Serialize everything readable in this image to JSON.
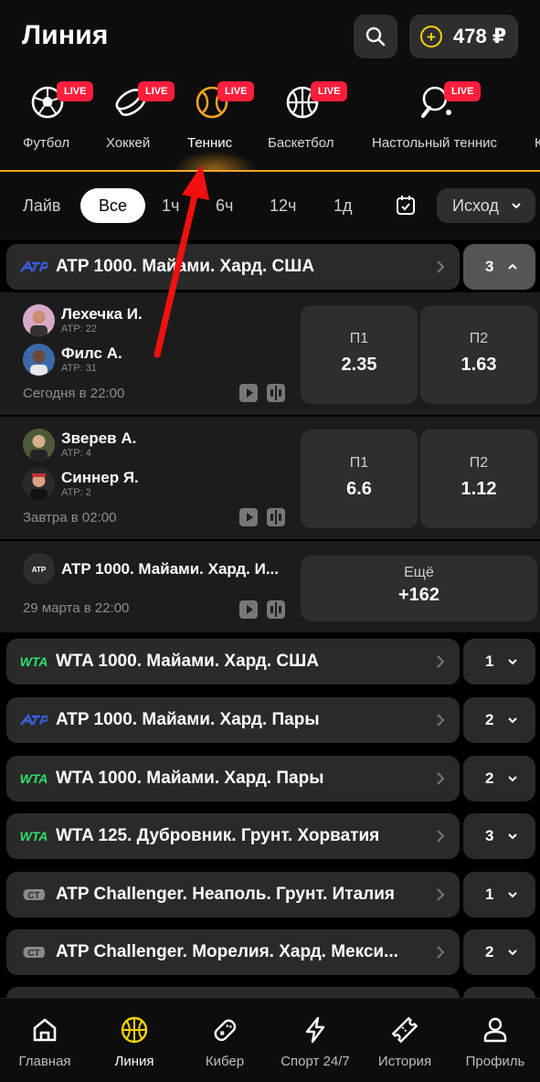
{
  "header": {
    "title": "Линия",
    "balance": "478 ₽"
  },
  "sports": [
    {
      "label": "Футбол",
      "icon": "soccer-ball-icon",
      "live": "LIVE"
    },
    {
      "label": "Хоккей",
      "icon": "hockey-puck-icon",
      "live": "LIVE"
    },
    {
      "label": "Теннис",
      "icon": "tennis-ball-icon",
      "live": "LIVE",
      "active": true
    },
    {
      "label": "Баскетбол",
      "icon": "basketball-icon",
      "live": "LIVE"
    },
    {
      "label": "Настольный теннис",
      "icon": "table-tennis-icon",
      "live": "LIVE"
    },
    {
      "label": "К",
      "icon": "partial-icon"
    }
  ],
  "filters": {
    "items": [
      "Лайв",
      "Все",
      "1ч",
      "6ч",
      "12ч",
      "1д"
    ],
    "active": "Все",
    "outcome": "Исход"
  },
  "leagues": [
    {
      "name": "ATP 1000. Майами. Хард. США",
      "count": "3",
      "logo": "atp",
      "expanded": true
    },
    {
      "name": "WTA 1000. Майами. Хард. США",
      "count": "1",
      "logo": "wta"
    },
    {
      "name": "ATP 1000. Майами. Хард. Пары",
      "count": "2",
      "logo": "atp"
    },
    {
      "name": "WTA 1000. Майами. Хард. Пары",
      "count": "2",
      "logo": "wta"
    },
    {
      "name": "WTA 125. Дубровник. Грунт. Хорватия",
      "count": "3",
      "logo": "wta"
    },
    {
      "name": "ATP Challenger. Неаполь. Грунт. Италия",
      "count": "1",
      "logo": "atp-challenger"
    },
    {
      "name": "ATP Challenger. Морелия. Хард. Мекси...",
      "count": "2",
      "logo": "atp-challenger"
    }
  ],
  "matches": [
    {
      "p1": {
        "name": "Лехечка И.",
        "rank": "ATP: 22"
      },
      "p2": {
        "name": "Филс А.",
        "rank": "ATP: 31"
      },
      "time": "Сегодня в 22:00",
      "odds": [
        {
          "label": "П1",
          "value": "2.35"
        },
        {
          "label": "П2",
          "value": "1.63"
        }
      ]
    },
    {
      "p1": {
        "name": "Зверев А.",
        "rank": "ATP: 4"
      },
      "p2": {
        "name": "Синнер Я.",
        "rank": "ATP: 2"
      },
      "time": "Завтра в 02:00",
      "odds": [
        {
          "label": "П1",
          "value": "6.6"
        },
        {
          "label": "П2",
          "value": "1.12"
        }
      ]
    },
    {
      "title": "ATP 1000. Майами. Хард. И...",
      "time": "29 марта в 22:00",
      "more": {
        "label": "Ещё",
        "value": "+162"
      }
    }
  ],
  "nav": [
    {
      "label": "Главная",
      "icon": "home-icon"
    },
    {
      "label": "Линия",
      "icon": "basketball-icon",
      "active": true
    },
    {
      "label": "Кибер",
      "icon": "gamepad-icon"
    },
    {
      "label": "Спорт 24/7",
      "icon": "lightning-icon"
    },
    {
      "label": "История",
      "icon": "ticket-icon"
    },
    {
      "label": "Профиль",
      "icon": "user-icon"
    }
  ],
  "colors": {
    "accent": "#f5a623",
    "live": "#ff1e3c",
    "wta": "#2de06a",
    "atp": "#3b5bdb",
    "coin": "#f5d300"
  }
}
